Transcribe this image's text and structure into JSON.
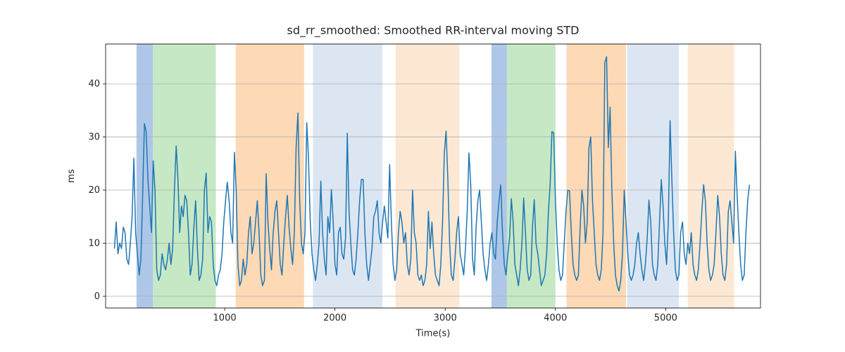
{
  "chart_data": {
    "type": "line",
    "title": "sd_rr_smoothed: Smoothed RR-interval moving STD",
    "xlabel": "Time(s)",
    "ylabel": "ms",
    "xlim": [
      -80,
      5860
    ],
    "ylim": [
      -2.2,
      47.5
    ],
    "xticks": [
      1000,
      2000,
      3000,
      4000,
      5000
    ],
    "yticks": [
      0,
      10,
      20,
      30,
      40
    ],
    "background_spans": [
      {
        "x0": 200,
        "x1": 350,
        "color": "#aec7e8"
      },
      {
        "x0": 350,
        "x1": 920,
        "color": "#c6e8c4"
      },
      {
        "x0": 1100,
        "x1": 1720,
        "color": "#fdd9b5"
      },
      {
        "x0": 1800,
        "x1": 2430,
        "color": "#dce6f2"
      },
      {
        "x0": 2550,
        "x1": 3130,
        "color": "#fde8d3"
      },
      {
        "x0": 3420,
        "x1": 3560,
        "color": "#aec7e8"
      },
      {
        "x0": 3560,
        "x1": 4000,
        "color": "#c6e8c4"
      },
      {
        "x0": 4100,
        "x1": 4640,
        "color": "#fdd9b5"
      },
      {
        "x0": 4650,
        "x1": 5120,
        "color": "#dce6f2"
      },
      {
        "x0": 5200,
        "x1": 5620,
        "color": "#fde8d3"
      }
    ],
    "x_start": 0,
    "x_step": 16,
    "values": [
      9,
      14,
      8,
      10,
      9,
      13,
      12,
      7,
      6,
      10,
      15,
      26,
      12,
      8,
      4,
      7,
      19,
      32.5,
      31,
      22,
      17,
      12,
      25.5,
      20,
      5,
      3,
      4,
      8,
      6,
      5,
      7,
      10,
      6,
      9,
      20,
      28.3,
      22,
      12,
      17,
      15,
      19,
      18,
      12,
      4,
      6,
      13,
      18,
      9,
      3,
      4,
      7,
      20,
      23.2,
      12,
      15,
      14,
      6,
      3,
      2,
      4,
      5,
      8,
      14,
      18,
      21.5,
      18,
      12,
      10,
      27.1,
      20,
      6,
      2,
      3,
      7,
      4,
      6,
      12,
      15,
      8,
      10,
      14,
      18,
      12,
      4,
      2,
      3,
      23.1,
      14,
      9,
      5,
      12,
      16,
      18,
      12,
      6,
      4,
      10,
      15,
      19,
      13,
      9,
      6,
      12,
      28,
      34.5,
      18,
      10,
      8,
      12,
      32.7,
      26,
      14,
      8,
      5,
      3,
      6,
      10,
      21.7,
      12,
      7,
      4,
      15,
      12,
      20.1,
      14,
      6,
      4,
      12,
      13,
      8,
      7,
      11,
      30.7,
      16,
      10,
      5,
      4,
      7,
      12,
      18,
      22,
      22,
      12,
      6,
      3,
      6,
      9,
      15,
      16,
      18,
      12,
      10,
      14,
      17,
      14,
      11,
      24.8,
      14,
      6,
      3,
      5,
      12,
      16,
      14,
      10,
      12,
      6,
      4,
      7,
      20,
      12,
      10,
      4,
      3,
      4,
      2,
      3,
      6,
      16,
      9,
      14,
      8,
      4,
      3,
      2,
      6,
      14,
      27,
      31.1,
      22,
      10,
      4,
      3,
      7,
      12,
      15,
      8,
      6,
      4,
      9,
      16,
      27,
      21,
      7,
      4,
      13,
      18,
      20,
      14,
      8,
      5,
      3,
      6,
      10,
      12,
      8,
      7,
      14,
      18,
      21,
      12,
      6,
      4,
      8,
      11,
      18.4,
      14,
      6,
      4,
      2,
      5,
      10,
      18.5,
      12,
      5,
      3,
      4,
      13,
      18.2,
      10,
      8,
      5,
      2,
      3,
      4,
      8,
      16,
      21,
      31,
      30.8,
      18,
      10,
      5,
      3,
      4,
      10,
      16,
      20,
      19.8,
      12,
      6,
      4,
      3,
      4,
      13,
      20,
      17,
      10,
      14,
      28,
      30,
      18,
      12,
      6,
      4,
      3,
      5,
      12,
      44,
      45.1,
      28,
      35.6,
      20,
      10,
      4,
      2,
      1,
      3,
      8,
      20,
      14,
      8,
      4,
      3,
      4,
      6,
      10,
      12,
      8,
      5,
      3,
      6,
      11,
      18.1,
      14,
      6,
      4,
      3,
      6,
      14,
      22,
      17,
      10,
      6,
      14,
      33.1,
      22,
      12,
      5,
      3,
      4,
      12,
      14,
      8,
      6,
      10,
      8,
      12,
      6,
      4,
      3,
      5,
      10,
      16,
      21,
      18,
      10,
      5,
      3,
      4,
      6,
      12,
      19,
      15,
      8,
      4,
      3,
      6,
      16,
      18,
      14,
      10,
      27.3,
      19,
      12,
      6,
      3,
      4,
      12,
      18,
      21
    ]
  }
}
